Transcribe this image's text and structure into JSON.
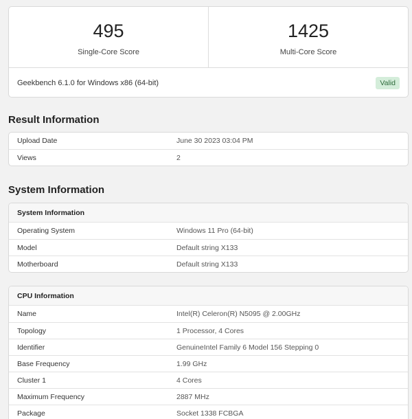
{
  "scores": {
    "single_value": "495",
    "single_label": "Single-Core Score",
    "multi_value": "1425",
    "multi_label": "Multi-Core Score"
  },
  "version": {
    "text": "Geekbench 6.1.0 for Windows x86 (64-bit)",
    "badge": "Valid"
  },
  "result_info": {
    "title": "Result Information",
    "rows": [
      {
        "label": "Upload Date",
        "value": "June 30 2023 03:04 PM"
      },
      {
        "label": "Views",
        "value": "2"
      }
    ]
  },
  "system_info": {
    "title": "System Information",
    "system_card": {
      "header": "System Information",
      "rows": [
        {
          "label": "Operating System",
          "value": "Windows 11 Pro (64-bit)"
        },
        {
          "label": "Model",
          "value": "Default string X133"
        },
        {
          "label": "Motherboard",
          "value": "Default string X133"
        }
      ]
    },
    "cpu_card": {
      "header": "CPU Information",
      "rows": [
        {
          "label": "Name",
          "value": "Intel(R) Celeron(R) N5095 @ 2.00GHz"
        },
        {
          "label": "Topology",
          "value": "1 Processor, 4 Cores"
        },
        {
          "label": "Identifier",
          "value": "GenuineIntel Family 6 Model 156 Stepping 0"
        },
        {
          "label": "Base Frequency",
          "value": "1.99 GHz"
        },
        {
          "label": "Cluster 1",
          "value": "4 Cores"
        },
        {
          "label": "Maximum Frequency",
          "value": "2887 MHz"
        },
        {
          "label": "Package",
          "value": "Socket 1338 FCBGA"
        }
      ]
    }
  },
  "colors": {
    "page_bg": "#f2f2f2",
    "valid_bg": "#d4edda",
    "valid_text": "#2d6a3a"
  }
}
